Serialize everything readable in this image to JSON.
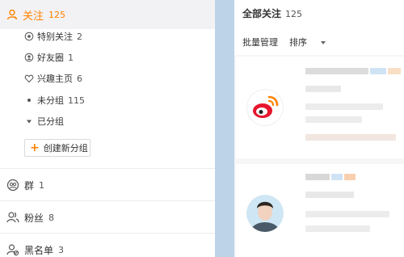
{
  "sidebar": {
    "follow": {
      "label": "关注",
      "count": "125"
    },
    "sub_items": [
      {
        "label": "特别关注",
        "count": "2",
        "icon": "star-circle-icon"
      },
      {
        "label": "好友圈",
        "count": "1",
        "icon": "friends-circle-icon"
      },
      {
        "label": "兴趣主页",
        "count": "6",
        "icon": "heart-interest-icon"
      },
      {
        "label": "未分组",
        "count": "115",
        "icon": "dot-icon"
      },
      {
        "label": "已分组",
        "count": "",
        "icon": "caret-down-icon"
      }
    ],
    "create_group": "创建新分组",
    "groups": {
      "label": "群",
      "count": "1"
    },
    "fans": {
      "label": "粉丝",
      "count": "8"
    },
    "blacklist": {
      "label": "黑名单",
      "count": "3"
    }
  },
  "panel": {
    "title": "全部关注",
    "count": "125",
    "batch_manage": "批量管理",
    "sort": "排序"
  },
  "colors": {
    "accent": "#ff8200",
    "weibo_red": "#e6162d"
  }
}
